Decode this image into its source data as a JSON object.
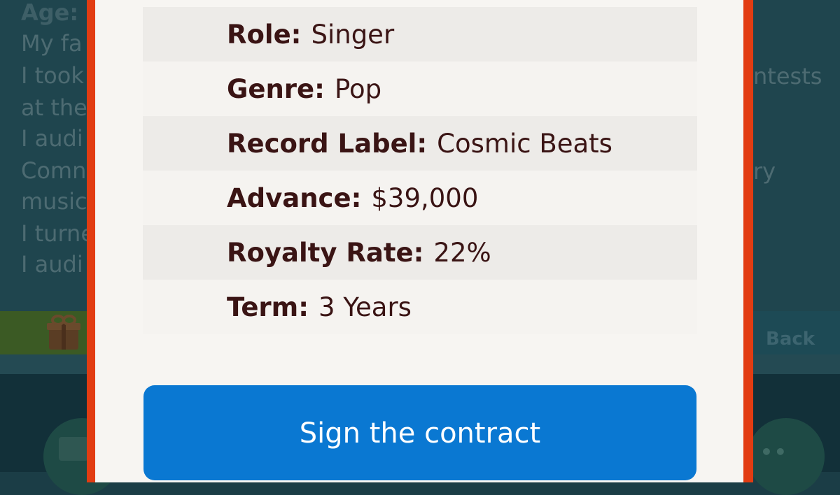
{
  "background": {
    "lines": [
      "Age:",
      "My fa",
      "I took",
      "at the",
      "I audi",
      "Comn",
      "music",
      "I turne",
      "I audi"
    ],
    "right_fragments": [
      "ntests",
      "ry"
    ],
    "back_label": "Back"
  },
  "contract": {
    "rows": [
      {
        "key": "Role:",
        "value": "Singer"
      },
      {
        "key": "Genre:",
        "value": "Pop"
      },
      {
        "key": "Record Label:",
        "value": "Cosmic Beats"
      },
      {
        "key": "Advance:",
        "value": "$39,000"
      },
      {
        "key": "Royalty Rate:",
        "value": "22%"
      },
      {
        "key": "Term:",
        "value": "3 Years"
      }
    ],
    "sign_button_label": "Sign the contract"
  },
  "colors": {
    "modal_border": "#e23c12",
    "button": "#0a78d2",
    "text": "#3a1414"
  },
  "icons": [
    "gift-icon",
    "briefcase-icon",
    "more-icon"
  ]
}
